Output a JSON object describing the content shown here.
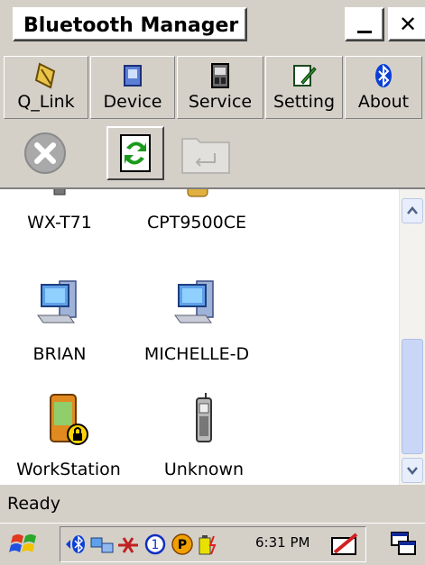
{
  "window": {
    "title": "Bluetooth Manager",
    "minimize_glyph": "",
    "close_glyph": "✕"
  },
  "menu": [
    {
      "label": "Q_Link",
      "icon": "q-link-icon"
    },
    {
      "label": "Device",
      "icon": "device-icon"
    },
    {
      "label": "Service",
      "icon": "service-icon"
    },
    {
      "label": "Setting",
      "icon": "setting-icon"
    },
    {
      "label": "About",
      "icon": "bluetooth-icon"
    }
  ],
  "actions": [
    {
      "icon": "stop-icon",
      "enabled": false
    },
    {
      "icon": "refresh-icon",
      "enabled": true
    },
    {
      "icon": "folder-return-icon",
      "enabled": false
    }
  ],
  "devices": [
    {
      "label": "WX-T71",
      "icon": "phone-icon"
    },
    {
      "label": "CPT9500CE",
      "icon": "pda-icon"
    },
    {
      "label": "BRIAN",
      "icon": "computer-icon"
    },
    {
      "label": "MICHELLE-D",
      "icon": "computer-icon"
    },
    {
      "label": "WorkStation",
      "icon": "locked-pda-icon"
    },
    {
      "label": "Unknown",
      "icon": "phone-icon"
    }
  ],
  "status": {
    "text": "Ready"
  },
  "taskbar": {
    "clock": "6:31 PM"
  },
  "colors": {
    "background": "#d4d0c8",
    "pane": "#ffffff",
    "scroll_thumb": "#c9d6f6",
    "bluetooth": "#0b3fd8"
  }
}
